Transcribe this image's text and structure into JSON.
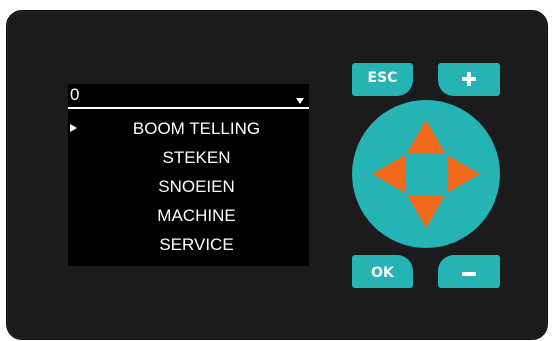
{
  "display": {
    "counter_value": "0",
    "menu_items": [
      {
        "label": "BOOM TELLING",
        "selected": true
      },
      {
        "label": "STEKEN",
        "selected": false
      },
      {
        "label": "SNOEIEN",
        "selected": false
      },
      {
        "label": "MACHINE",
        "selected": false
      },
      {
        "label": "SERVICE",
        "selected": false
      }
    ]
  },
  "keys": {
    "esc_label": "ESC",
    "ok_label": "OK",
    "plus_symbol": "+",
    "minus_symbol": "−",
    "dpad_icons": [
      "arrow-up-icon",
      "arrow-down-icon",
      "arrow-left-icon",
      "arrow-right-icon"
    ]
  },
  "colors": {
    "panel": "#1b1b1d",
    "screen": "#000000",
    "key_teal": "#25b3b3",
    "arrow_orange": "#f26b1d",
    "text": "#ffffff"
  }
}
